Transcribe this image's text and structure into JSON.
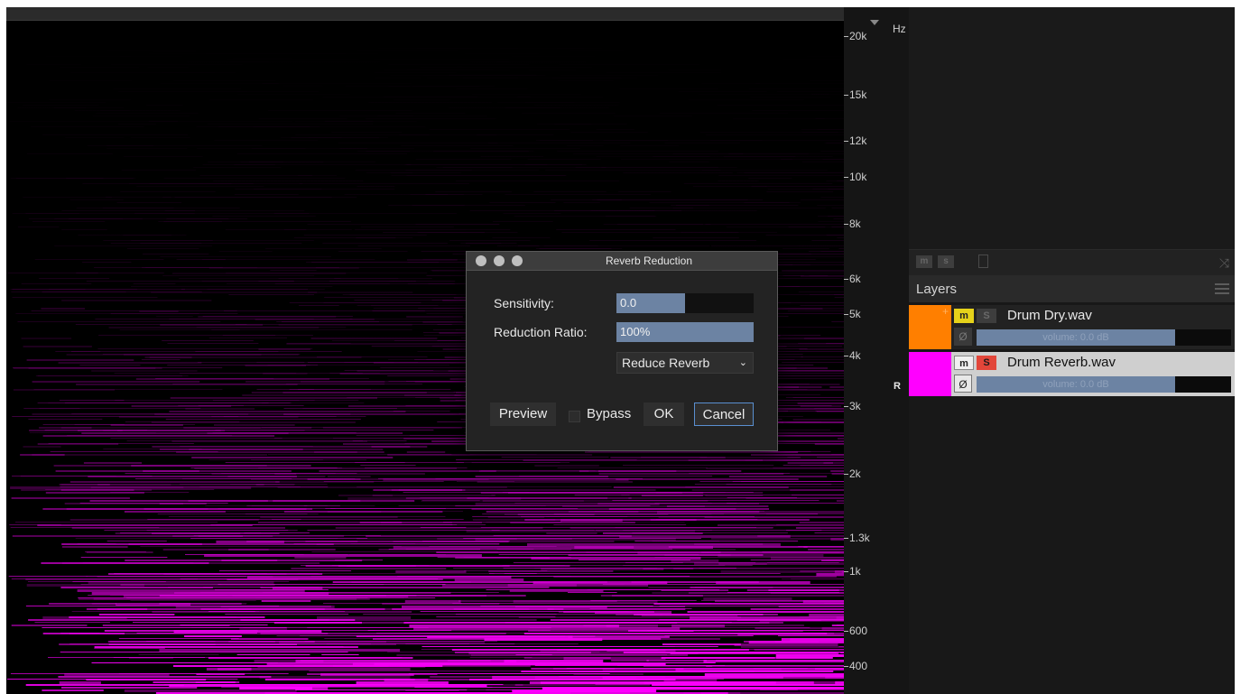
{
  "freq_scale": {
    "unit": "Hz",
    "side_label": "R",
    "ticks": [
      {
        "label": "20k",
        "value_hz": 20000
      },
      {
        "label": "15k",
        "value_hz": 15000
      },
      {
        "label": "12k",
        "value_hz": 12000
      },
      {
        "label": "10k",
        "value_hz": 10000
      },
      {
        "label": "8k",
        "value_hz": 8000
      },
      {
        "label": "6k",
        "value_hz": 6000
      },
      {
        "label": "5k",
        "value_hz": 5000
      },
      {
        "label": "4k",
        "value_hz": 4000
      },
      {
        "label": "3k",
        "value_hz": 3000
      },
      {
        "label": "2k",
        "value_hz": 2000
      },
      {
        "label": "1.3k",
        "value_hz": 1300
      },
      {
        "label": "1k",
        "value_hz": 1000
      },
      {
        "label": "600",
        "value_hz": 600
      },
      {
        "label": "400",
        "value_hz": 400
      }
    ]
  },
  "spectrogram": {
    "color": "#ff00ff"
  },
  "panel": {
    "layers_title": "Layers",
    "toolbar": {
      "m_label": "m",
      "s_label": "s"
    },
    "layers": [
      {
        "name": "Drum Dry.wav",
        "color": "#ff7f00",
        "m_label": "m",
        "s_label": "S",
        "phase_label": "Ø",
        "volume_text": "volume: 0.0 dB",
        "volume_level": 0.78,
        "selected": false
      },
      {
        "name": "Drum Reverb.wav",
        "color": "#ff00ff",
        "m_label": "m",
        "s_label": "S",
        "phase_label": "Ø",
        "volume_text": "volume: 0.0 dB",
        "volume_level": 0.78,
        "selected": true
      }
    ]
  },
  "dialog": {
    "title": "Reverb Reduction",
    "sensitivity_label": "Sensitivity:",
    "sensitivity_value": "0.0",
    "sensitivity_level": 0.5,
    "ratio_label": "Reduction Ratio:",
    "ratio_value": "100%",
    "ratio_level": 1.0,
    "mode_value": "Reduce Reverb",
    "preview_label": "Preview",
    "bypass_label": "Bypass",
    "ok_label": "OK",
    "cancel_label": "Cancel"
  }
}
